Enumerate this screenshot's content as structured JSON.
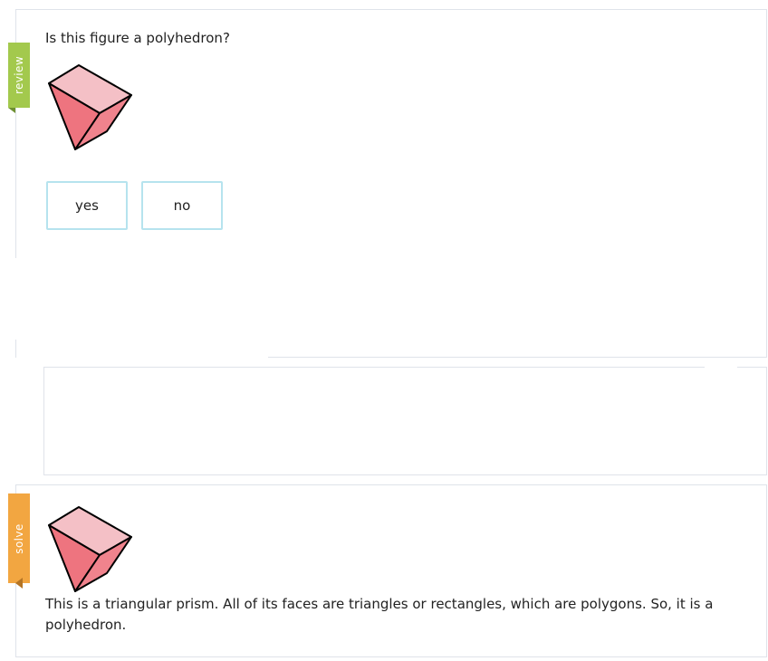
{
  "review": {
    "ribbon_label": "review",
    "question": "Is this figure a polyhedron?",
    "answers": [
      "yes",
      "no"
    ]
  },
  "solve": {
    "ribbon_label": "solve",
    "explanation": "This is a triangular prism. All of its faces are triangles or rectangles, which are polygons. So, it is a polyhedron."
  },
  "colors": {
    "review_ribbon": "#a3c94d",
    "solve_ribbon": "#f2a641",
    "answer_border": "#b6e3ee",
    "prism_top": "#f4c0c6",
    "prism_front": "#ee747f",
    "prism_side": "#f0838d"
  },
  "icons": {
    "figure": "triangular-prism-figure"
  }
}
